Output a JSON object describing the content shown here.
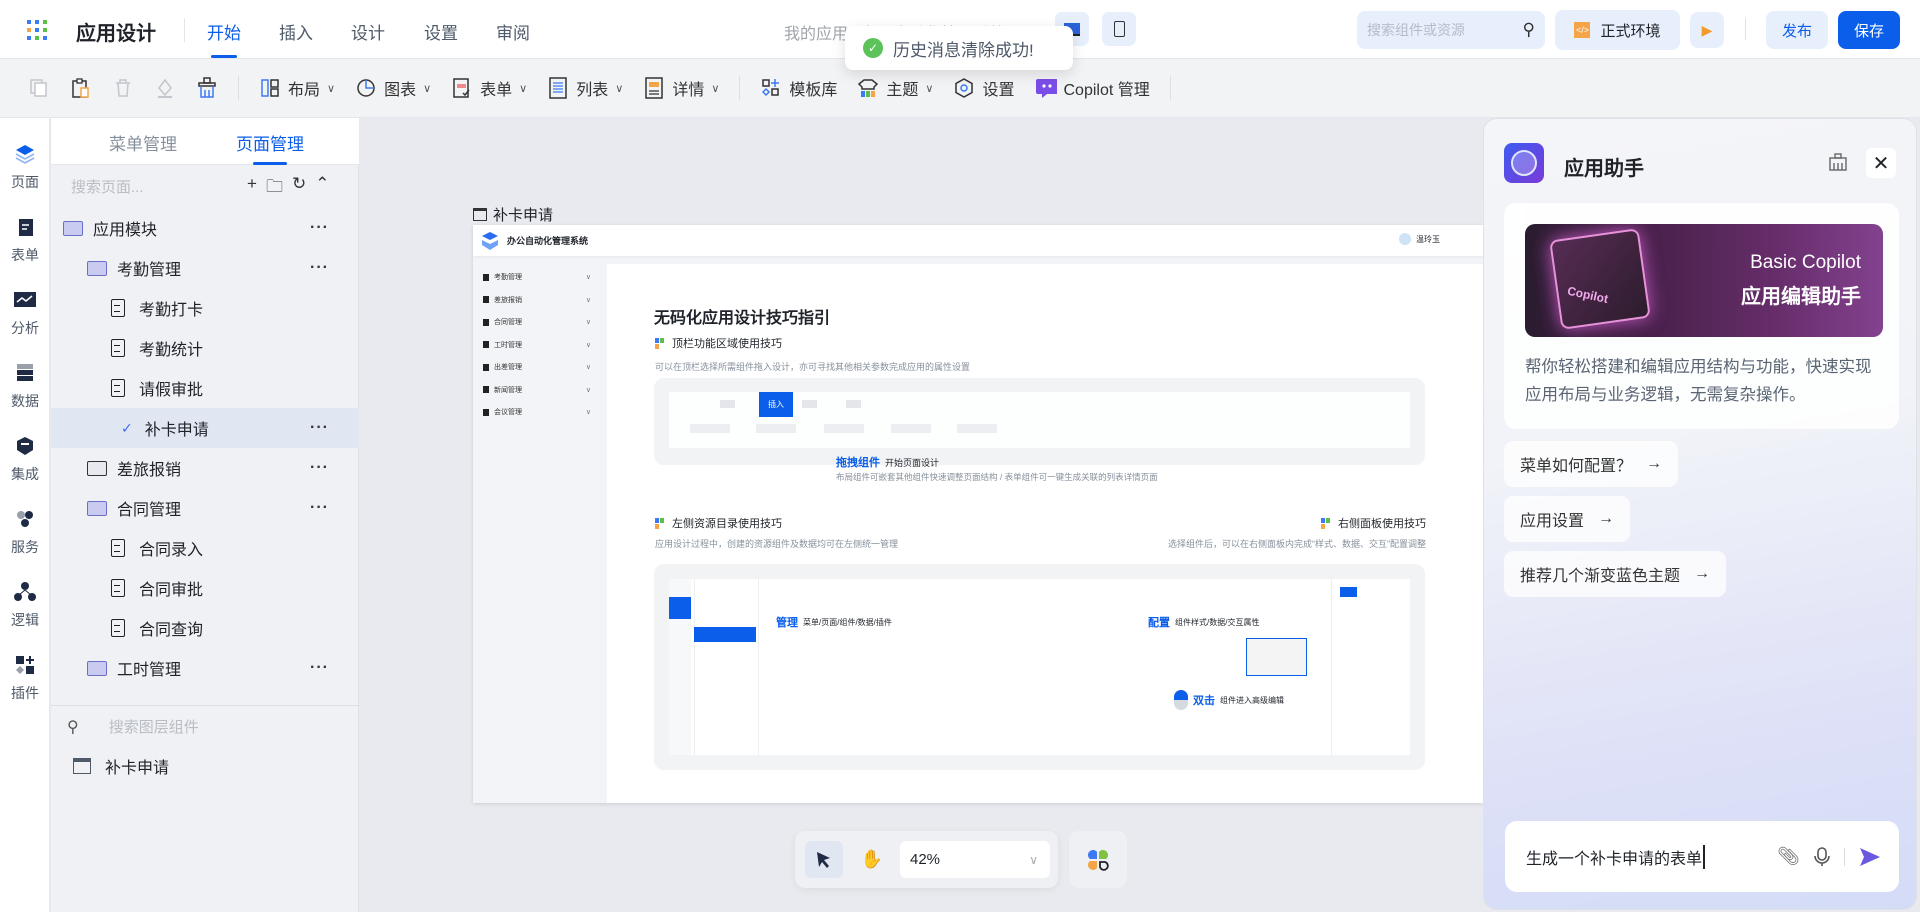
{
  "header": {
    "app_title": "应用设计",
    "tabs": [
      {
        "label": "开始",
        "active": true
      },
      {
        "label": "插入"
      },
      {
        "label": "设计"
      },
      {
        "label": "设置"
      },
      {
        "label": "审阅"
      }
    ],
    "breadcrumb": "我的应用  /  办公自动化管理系统",
    "toast": "历史消息清除成功!",
    "search_placeholder": "搜索组件或资源",
    "env_label": "正式环境",
    "publish_label": "发布",
    "save_label": "保存",
    "accent": "#0a5eea"
  },
  "toolbar": {
    "layout": "布局",
    "chart": "图表",
    "form": "表单",
    "list": "列表",
    "detail": "详情",
    "template": "模板库",
    "theme": "主题",
    "settings": "设置",
    "copilot": "Copilot 管理"
  },
  "rail": [
    "页面",
    "表单",
    "分析",
    "数据",
    "集成",
    "服务",
    "逻辑",
    "插件"
  ],
  "left_panel": {
    "tabs": [
      "菜单管理",
      "页面管理"
    ],
    "search_placeholder": "搜索页面...",
    "tree": [
      {
        "label": "应用模块",
        "type": "folder",
        "level": 0
      },
      {
        "label": "考勤管理",
        "type": "folder",
        "level": 1
      },
      {
        "label": "考勤打卡",
        "type": "page",
        "level": 2
      },
      {
        "label": "考勤统计",
        "type": "page",
        "level": 2
      },
      {
        "label": "请假审批",
        "type": "page",
        "level": 2
      },
      {
        "label": "补卡申请",
        "type": "page",
        "level": 2,
        "selected": true
      },
      {
        "label": "差旅报销",
        "type": "folder",
        "level": 1
      },
      {
        "label": "合同管理",
        "type": "folder",
        "level": 1
      },
      {
        "label": "合同录入",
        "type": "page",
        "level": 2
      },
      {
        "label": "合同审批",
        "type": "page",
        "level": 2
      },
      {
        "label": "合同查询",
        "type": "page",
        "level": 2
      },
      {
        "label": "工时管理",
        "type": "folder",
        "level": 1
      }
    ],
    "layer_search_placeholder": "搜索图层组件",
    "layer_item": "补卡申请"
  },
  "canvas": {
    "frame_label": "补卡申请",
    "preview": {
      "system_name": "办公自动化管理系统",
      "user": "温玲玉",
      "menu": [
        "考勤管理",
        "差旅报销",
        "合同管理",
        "工时管理",
        "出差管理",
        "新闻管理",
        "会议管理"
      ],
      "title": "无码化应用设计技巧指引",
      "s1_title": "顶栏功能区域使用技巧",
      "s1_desc": "可以在顶栏选择所需组件拖入设计，亦可寻找其他相关参数完成应用的属性设置",
      "s1_tab": "插入",
      "drag_title": "拖拽组件",
      "drag_sub": "开始页面设计",
      "drag_desc": "布局组件可嵌套其他组件快速调整页面结构 / 表单组件可一键生成关联的列表详情页面",
      "s2_title": "左侧资源目录使用技巧",
      "s2_desc": "应用设计过程中，创建的资源组件及数据均可在左侧统一管理",
      "s3_title": "右侧面板使用技巧",
      "s3_desc": "选择组件后，可以在右侧面板内完成“样式、数据、交互”配置调整",
      "manage_title": "管理",
      "manage_desc": "菜单/页面/组件/数据/插件",
      "config_title": "配置",
      "config_desc": "组件样式/数据/交互属性",
      "dbl_title": "双击",
      "dbl_desc": "组件进入高级编辑"
    },
    "zoom": "42%"
  },
  "assistant": {
    "title": "应用助手",
    "banner_en": "Basic Copilot",
    "banner_cn": "应用编辑助手",
    "banner_logo_text": "Copilot",
    "description": "帮你轻松搭建和编辑应用结构与功能，快速实现应用布局与业务逻辑，无需复杂操作。",
    "suggestions": [
      "菜单如何配置？",
      "应用设置",
      "推荐几个渐变蓝色主题"
    ],
    "input_value": "生成一个补卡申请的表单",
    "send_color": "#6a5ae0"
  }
}
